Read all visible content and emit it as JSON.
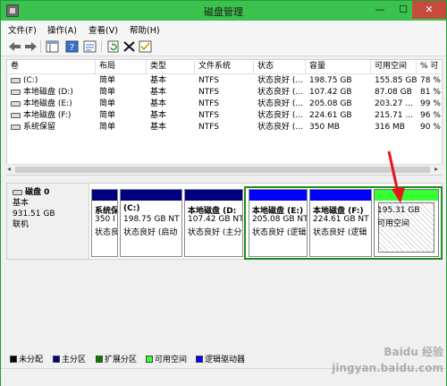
{
  "window": {
    "title": "磁盘管理",
    "minimize": "—",
    "maximize": "☐",
    "close": "✕"
  },
  "menu": [
    "文件(F)",
    "操作(A)",
    "查看(V)",
    "帮助(H)"
  ],
  "columns": [
    "卷",
    "布局",
    "类型",
    "文件系统",
    "状态",
    "容量",
    "可用空间",
    "% 可"
  ],
  "volumes": [
    [
      "(C:)",
      "简单",
      "基本",
      "NTFS",
      "状态良好 (...",
      "198.75 GB",
      "155.85 GB",
      "78 %"
    ],
    [
      "本地磁盘 (D:)",
      "简单",
      "基本",
      "NTFS",
      "状态良好 (...",
      "107.42 GB",
      "87.08 GB",
      "81 %"
    ],
    [
      "本地磁盘 (E:)",
      "简单",
      "基本",
      "NTFS",
      "状态良好 (...",
      "205.08 GB",
      "203.27 ...",
      "99 %"
    ],
    [
      "本地磁盘 (F:)",
      "简单",
      "基本",
      "NTFS",
      "状态良好 (...",
      "224.61 GB",
      "215.71 ...",
      "96 %"
    ],
    [
      "系统保留",
      "简单",
      "基本",
      "NTFS",
      "状态良好 (...",
      "350 MB",
      "316 MB",
      "90 %"
    ]
  ],
  "disk": {
    "name": "磁盘 0",
    "type": "基本",
    "size": "931.51 GB",
    "status": "联机"
  },
  "partitions": [
    {
      "label": "系统保",
      "size": "350 I",
      "status": "状态良"
    },
    {
      "label": "(C:)",
      "size": "198.75 GB NT",
      "status": "状态良好 (启动"
    },
    {
      "label": "本地磁盘 (D:",
      "size": "107.42 GB NT",
      "status": "状态良好 (主分"
    },
    {
      "label": "本地磁盘 (E:)",
      "size": "205.08 GB NT",
      "status": "状态良好 (逻辑"
    },
    {
      "label": "本地磁盘 (F:)",
      "size": "224.61 GB NT",
      "status": "状态良好 (逻辑"
    },
    {
      "label": "",
      "size": "195.31 GB",
      "status": "可用空间"
    }
  ],
  "legend": [
    "未分配",
    "主分区",
    "扩展分区",
    "可用空间",
    "逻辑驱动器"
  ],
  "colors": {
    "unallocated": "#000000",
    "primary": "#000080",
    "extended": "#008000",
    "free": "#33ff33",
    "logical": "#0000ff",
    "arrow": "#e8141e"
  },
  "watermark": "Baidu 经验 jingyan.baidu.com"
}
